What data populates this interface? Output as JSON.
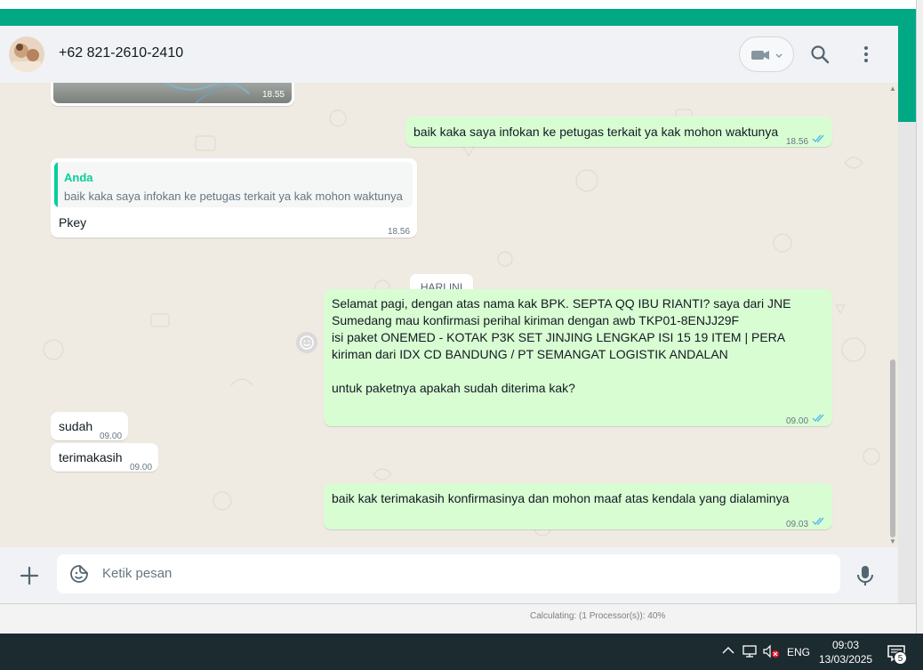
{
  "header": {
    "contact_name": "+62 821-2610-2410"
  },
  "messages": [
    {
      "id": "img",
      "type": "image",
      "time": "18.55"
    },
    {
      "id": "m1",
      "direction": "out",
      "text": "baik kaka saya infokan ke petugas terkait ya kak mohon waktunya",
      "time": "18.56",
      "status": "read"
    },
    {
      "id": "m2",
      "direction": "in",
      "quote_author": "Anda",
      "quote_text": "baik kaka saya infokan ke petugas terkait ya kak mohon waktunya",
      "text": "Pkey",
      "time": "18.56"
    },
    {
      "id": "m3",
      "direction": "out",
      "lines": [
        "Selamat  pagi, dengan atas nama kak BPK. SEPTA QQ IBU RIANTI?  saya dari JNE",
        "Sumedang mau konfirmasi perihal kiriman dengan awb TKP01-8ENJJ29F",
        "isi paket ONEMED - KOTAK P3K SET JINJING LENGKAP ISI 15 19 ITEM | PERA",
        "kiriman dari IDX CD BANDUNG / PT SEMANGAT LOGISTIK ANDALAN",
        "",
        "untuk paketnya apakah sudah diterima kak?"
      ],
      "time": "09.00",
      "status": "read"
    },
    {
      "id": "m4",
      "direction": "in",
      "text": "sudah",
      "time": "09.00"
    },
    {
      "id": "m5",
      "direction": "in",
      "text": "terimakasih",
      "time": "09.00"
    },
    {
      "id": "m6",
      "direction": "out",
      "text": "baik kak terimakasih konfirmasinya dan mohon maaf atas kendala yang dialaminya",
      "time": "09.03",
      "status": "read"
    }
  ],
  "date_divider": "HARI INI",
  "composer": {
    "placeholder": "Ketik pesan"
  },
  "taskbar": {
    "language": "ENG",
    "time": "09:03",
    "date": "13/03/2025",
    "notification_count": "5"
  },
  "background_window": {
    "status_text": "Calculating: (1 Processor(s)): 40%"
  },
  "colors": {
    "brand_green": "#00a884",
    "outgoing_bubble": "#d9fdd3",
    "incoming_bubble": "#ffffff",
    "chat_background": "#efeae2",
    "read_ticks": "#53bdeb",
    "quote_accent": "#06cf9c",
    "taskbar": "#1c2b30"
  }
}
